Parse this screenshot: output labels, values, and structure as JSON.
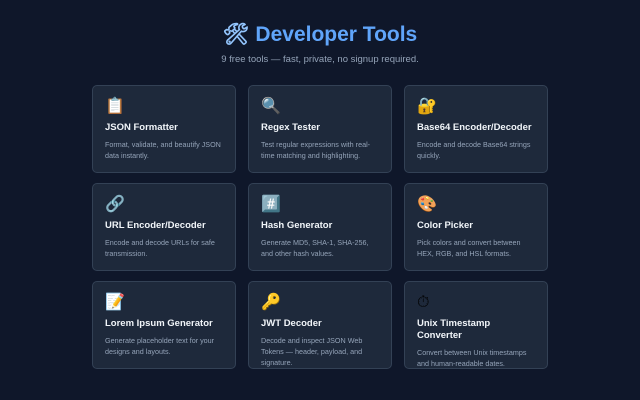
{
  "header": {
    "icon": "🛠",
    "title": "Developer Tools",
    "subtitle": "9 free tools — fast, private, no signup required."
  },
  "tools": [
    {
      "icon": "📋",
      "icon_name": "clipboard-icon",
      "title": "JSON Formatter",
      "description": "Format, validate, and beautify JSON data instantly."
    },
    {
      "icon": "🔍",
      "icon_name": "magnifier-icon",
      "title": "Regex Tester",
      "description": "Test regular expressions with real-time matching and highlighting."
    },
    {
      "icon": "🔐",
      "icon_name": "lock-icon",
      "title": "Base64 Encoder/Decoder",
      "description": "Encode and decode Base64 strings quickly."
    },
    {
      "icon": "🔗",
      "icon_name": "link-icon",
      "title": "URL Encoder/Decoder",
      "description": "Encode and decode URLs for safe transmission."
    },
    {
      "icon": "#️⃣",
      "icon_name": "hash-icon",
      "title": "Hash Generator",
      "description": "Generate MD5, SHA-1, SHA-256, and other hash values."
    },
    {
      "icon": "🎨",
      "icon_name": "palette-icon",
      "title": "Color Picker",
      "description": "Pick colors and convert between HEX, RGB, and HSL formats."
    },
    {
      "icon": "📝",
      "icon_name": "memo-icon",
      "title": "Lorem Ipsum Generator",
      "description": "Generate placeholder text for your designs and layouts."
    },
    {
      "icon": "🔑",
      "icon_name": "key-icon",
      "title": "JWT Decoder",
      "description": "Decode and inspect JSON Web Tokens — header, payload, and signature."
    },
    {
      "icon": "⏱",
      "icon_name": "stopwatch-icon",
      "title": "Unix Timestamp Converter",
      "description": "Convert between Unix timestamps and human-readable dates."
    }
  ],
  "colors": {
    "background": "#0f172a",
    "card": "#1e293b",
    "card_border": "#334155",
    "accent": "#60a5fa",
    "title_text": "#f1f5f9",
    "muted_text": "#94a3b8"
  }
}
